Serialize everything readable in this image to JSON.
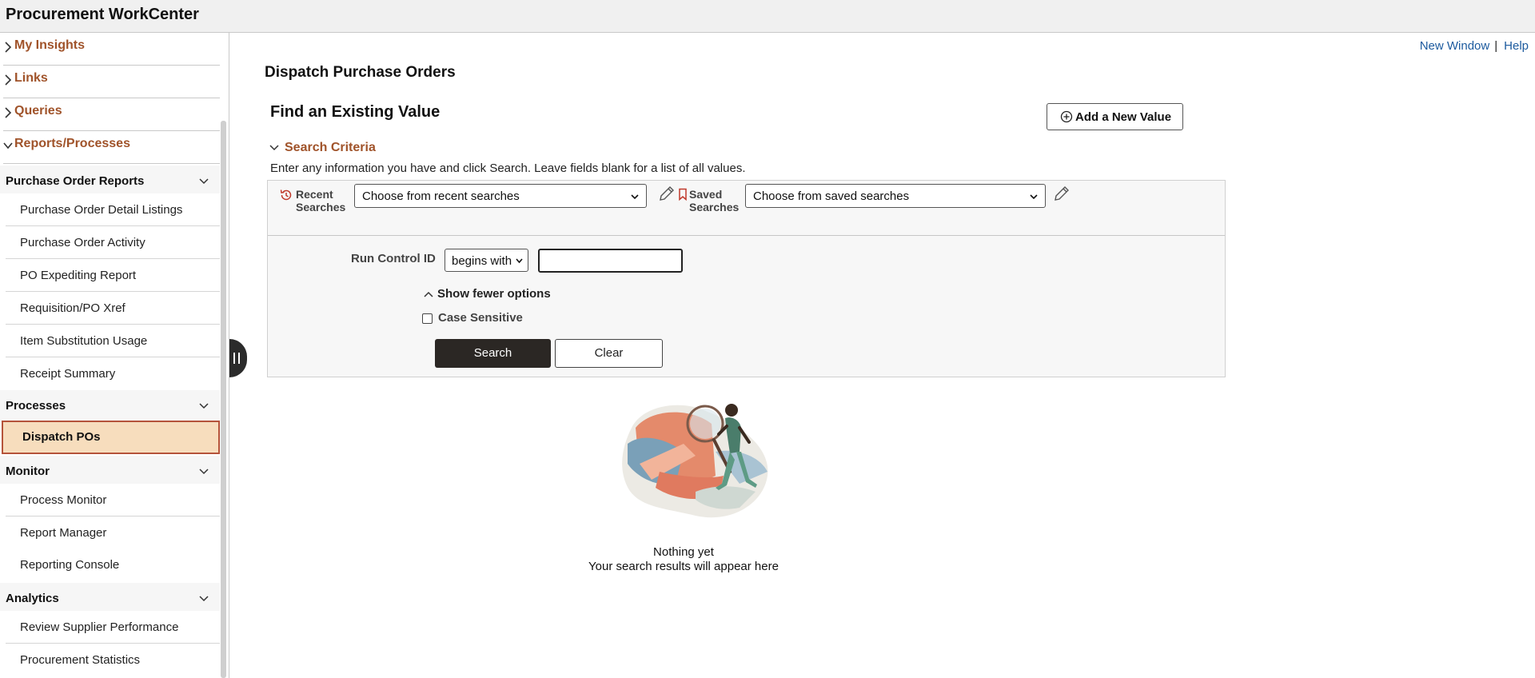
{
  "header": {
    "title": "Procurement WorkCenter"
  },
  "sidebar": {
    "accordions": [
      {
        "label": "My Insights",
        "expanded": false
      },
      {
        "label": "Links",
        "expanded": false
      },
      {
        "label": "Queries",
        "expanded": false
      },
      {
        "label": "Reports/Processes",
        "expanded": true
      }
    ],
    "groups": [
      {
        "title": "Purchase Order Reports",
        "items": [
          "Purchase Order Detail Listings",
          "Purchase Order Activity",
          "PO Expediting Report",
          "Requisition/PO Xref",
          "Item Substitution Usage",
          "Receipt Summary"
        ]
      },
      {
        "title": "Processes",
        "items": [
          "Dispatch POs"
        ]
      },
      {
        "title": "Monitor",
        "items": [
          "Process Monitor",
          "Report Manager",
          "Reporting Console"
        ]
      },
      {
        "title": "Analytics",
        "items": [
          "Review Supplier Performance",
          "Procurement Statistics"
        ]
      }
    ],
    "selected_item": "Dispatch POs"
  },
  "toplinks": {
    "new_window": "New Window",
    "separator": "|",
    "help": "Help"
  },
  "main": {
    "page_title": "Dispatch Purchase Orders",
    "find_title": "Find an Existing Value",
    "add_button": "Add a New Value",
    "criteria_header": "Search Criteria",
    "instructions": "Enter any information you have and click Search. Leave fields blank for a list of all values.",
    "recent": {
      "label_line1": "Recent",
      "label_line2": "Searches",
      "value": "Choose from recent searches"
    },
    "saved": {
      "label_line1": "Saved",
      "label_line2": "Searches",
      "value": "Choose from saved searches"
    },
    "run_control_label": "Run Control ID",
    "operator": "begins with",
    "run_control_value": "",
    "show_fewer": "Show fewer options",
    "case_sensitive_label": "Case Sensitive",
    "case_sensitive_checked": false,
    "search_button": "Search",
    "clear_button": "Clear",
    "empty_title": "Nothing yet",
    "empty_subtitle": "Your search results will appear here"
  },
  "colors": {
    "accent": "#a0532a",
    "link": "#1c5a9e",
    "selected_bg": "#f7ddbd",
    "selected_border": "#b5533a",
    "primary_button": "#2b2724"
  },
  "icons": [
    "chevron-right-icon",
    "chevron-down-icon",
    "history-icon",
    "bookmark-icon",
    "pencil-icon",
    "plus-circle-icon",
    "chevron-up-icon",
    "collapse-handle-icon"
  ]
}
